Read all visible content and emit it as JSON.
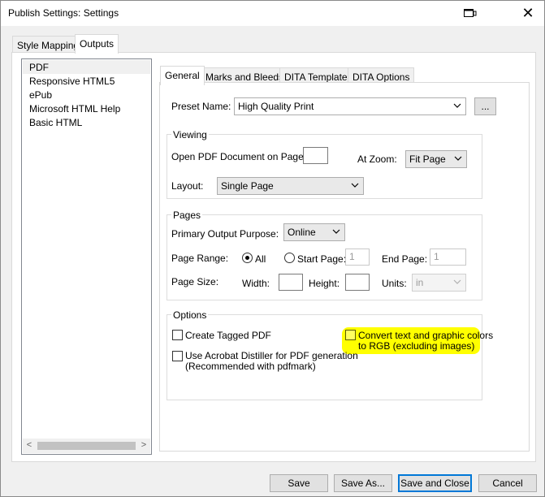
{
  "window": {
    "title": "Publish Settings: Settings",
    "restore_icon": "restore-window-icon",
    "close_label": "✕"
  },
  "top_tabs": [
    "Style Mapping",
    "Outputs"
  ],
  "active_top_tab": "Outputs",
  "formats": [
    "PDF",
    "Responsive HTML5",
    "ePub",
    "Microsoft HTML Help",
    "Basic HTML"
  ],
  "selected_format": "PDF",
  "scroll_arrows": {
    "left": "<",
    "right": ">"
  },
  "inner_tabs": [
    "General",
    "Marks and Bleeds",
    "DITA Template",
    "DITA Options"
  ],
  "active_inner_tab": "General",
  "preset": {
    "label": "Preset Name:",
    "value": "High Quality Print",
    "browse_label": "..."
  },
  "viewing": {
    "title": "Viewing",
    "open_page_label": "Open PDF Document on Page:",
    "open_page_value": "",
    "zoom_label": "At Zoom:",
    "zoom_value": "Fit Page",
    "layout_label": "Layout:",
    "layout_value": "Single Page"
  },
  "pages": {
    "title": "Pages",
    "purpose_label": "Primary Output Purpose:",
    "purpose_value": "Online",
    "range_label": "Page Range:",
    "all_label": "All",
    "start_label": "Start Page:",
    "start_value": "1",
    "end_label": "End Page:",
    "end_value": "1",
    "size_label": "Page Size:",
    "width_label": "Width:",
    "width_value": "",
    "height_label": "Height:",
    "height_value": "",
    "units_label": "Units:",
    "units_value": "in",
    "range_selected": "All"
  },
  "options": {
    "title": "Options",
    "tagged_pdf": "Create Tagged PDF",
    "convert_rgb_line1": "Convert text and graphic colors",
    "convert_rgb_line2": "to RGB (excluding images)",
    "distiller_line1": "Use Acrobat Distiller for PDF generation",
    "distiller_line2": "(Recommended with pdfmark)",
    "tagged_pdf_checked": false,
    "convert_rgb_checked": false,
    "distiller_checked": false,
    "highlight_color": "#ffff00"
  },
  "buttons": {
    "save": "Save",
    "save_as": "Save As...",
    "save_and_close": "Save and Close",
    "cancel": "Cancel"
  }
}
